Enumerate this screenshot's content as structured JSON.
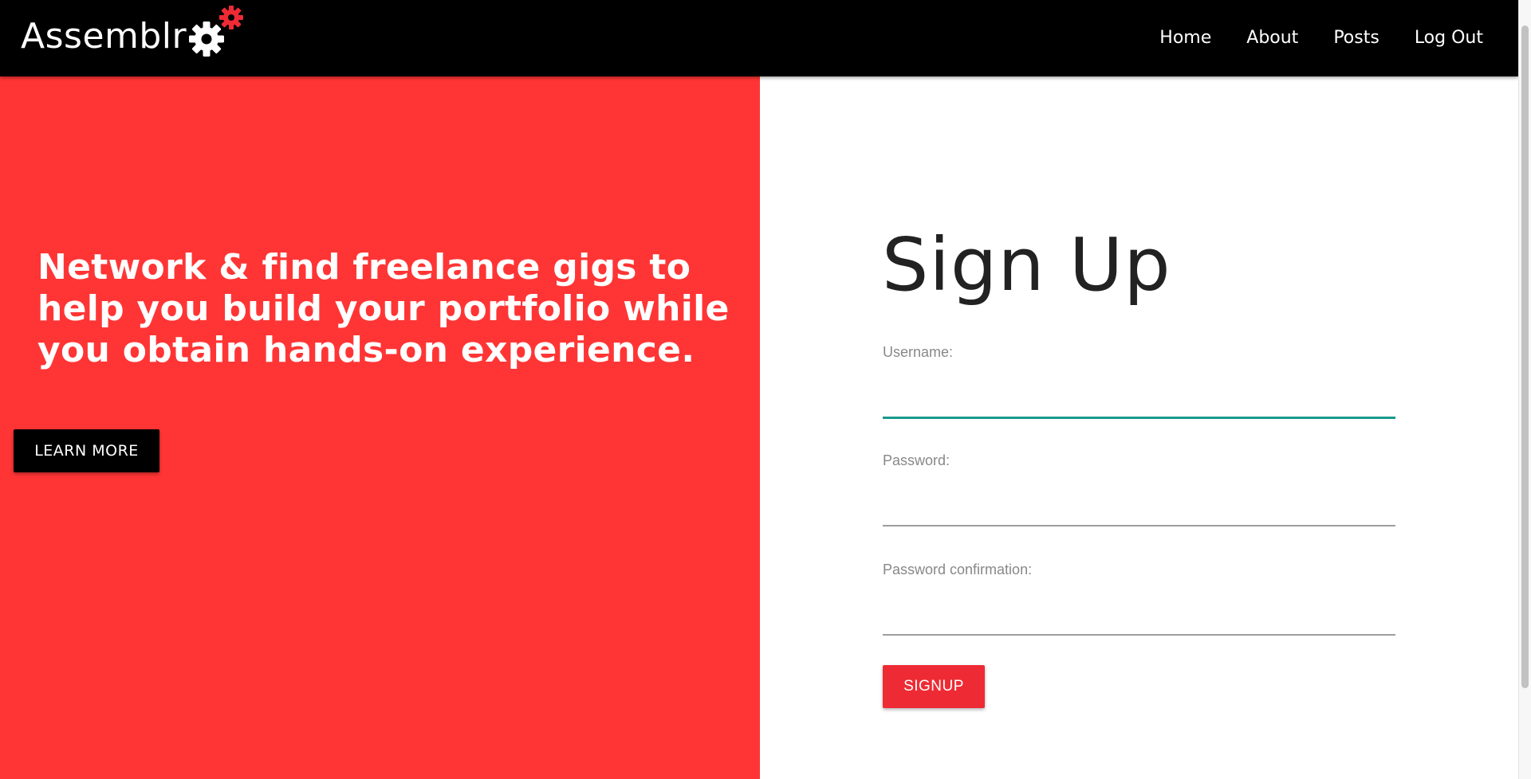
{
  "navbar": {
    "brand": "Assemblr",
    "links": [
      "Home",
      "About",
      "Posts",
      "Log Out"
    ]
  },
  "hero": {
    "headline": "Network & find freelance gigs to help you build your portfolio while you obtain hands-on experience.",
    "button_label": "LEARN MORE"
  },
  "form": {
    "title": "Sign Up",
    "username_label": "Username:",
    "username_value": "",
    "password_label": "Password:",
    "password_value": "",
    "password_confirmation_label": "Password confirmation:",
    "password_confirmation_value": "",
    "submit_label": "SIGNUP"
  },
  "icons": {
    "brand_gear": "gear-icon",
    "brand_gear_accent": "gear-icon"
  },
  "colors": {
    "navbar_bg": "#000000",
    "hero_bg": "#ff3535",
    "signup_button": "#ee2b34",
    "focus_underline": "#1a9a8c"
  }
}
